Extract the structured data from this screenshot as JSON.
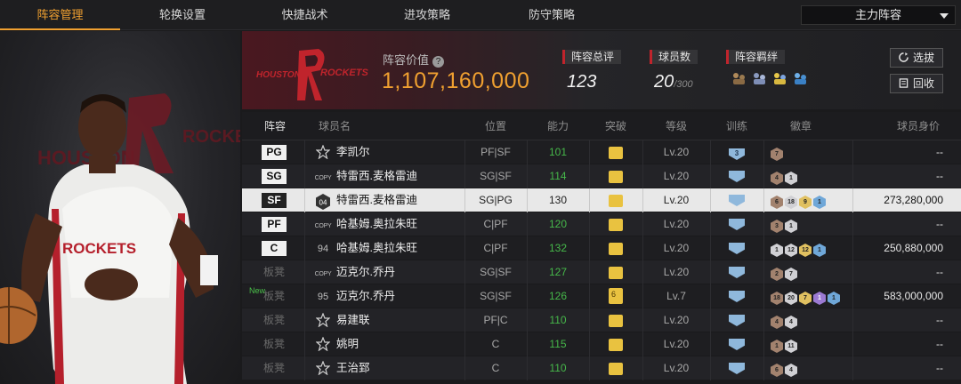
{
  "tabs": [
    {
      "label": "阵容管理",
      "active": true
    },
    {
      "label": "轮换设置",
      "active": false
    },
    {
      "label": "快捷战术",
      "active": false
    },
    {
      "label": "进攻策略",
      "active": false
    },
    {
      "label": "防守策略",
      "active": false
    }
  ],
  "lineup_select": {
    "value": "主力阵容"
  },
  "team": {
    "logo_left": "HOUSTON",
    "logo_right": "ROCKETS",
    "value_label": "阵容价值",
    "value_help": "?",
    "value": "1,107,160,000",
    "rating_label": "阵容总评",
    "rating": "123",
    "player_count_label": "球员数",
    "player_count": "20",
    "player_count_max": "/300",
    "bond_label": "阵容羁绊",
    "bond_icons": [
      "bond-icon-1",
      "bond-icon-2",
      "bond-icon-3",
      "bond-icon-4"
    ]
  },
  "buttons": {
    "select": "选拔",
    "recycle": "回收"
  },
  "hero_art": {
    "team_text_left": "HOUSTON",
    "team_text_right": "ROCKETS",
    "jersey_text": "ROCKETS"
  },
  "colors": {
    "accent": "#f0a030",
    "ability_green": "#46b84a",
    "rockets_red": "#c0242c"
  },
  "table": {
    "headers": {
      "slot": "阵容",
      "name": "球员名",
      "position": "位置",
      "ability": "能力",
      "breakthrough": "突破",
      "level": "等级",
      "training": "训练",
      "badges": "徽章",
      "price": "球员身价"
    },
    "rows": [
      {
        "slot": "PG",
        "bench": false,
        "new": "",
        "jersey": "star",
        "name": "李凯尔",
        "position": "PF|SF",
        "ability": "101",
        "breakthrough": "",
        "level": "Lv.20",
        "training": "3",
        "badges": [
          [
            "bronze",
            "7"
          ]
        ],
        "price": "--"
      },
      {
        "slot": "SG",
        "bench": false,
        "new": "",
        "jersey": "COPY",
        "name": "特雷西.麦格雷迪",
        "position": "SG|SF",
        "ability": "114",
        "breakthrough": "",
        "level": "Lv.20",
        "training": "",
        "badges": [
          [
            "bronze",
            "4"
          ],
          [
            "silver",
            "1"
          ]
        ],
        "price": "--"
      },
      {
        "slot": "SF",
        "bench": false,
        "new": "",
        "jersey": "04",
        "name": "特雷西.麦格雷迪",
        "position": "SG|PG",
        "ability": "130",
        "breakthrough": "",
        "level": "Lv.20",
        "training": "",
        "badges": [
          [
            "bronze",
            "6"
          ],
          [
            "silver",
            "18"
          ],
          [
            "gold",
            "9"
          ],
          [
            "blue",
            "1"
          ]
        ],
        "price": "273,280,000",
        "selected": true
      },
      {
        "slot": "PF",
        "bench": false,
        "new": "",
        "jersey": "COPY",
        "name": "哈基姆.奥拉朱旺",
        "position": "C|PF",
        "ability": "120",
        "breakthrough": "",
        "level": "Lv.20",
        "training": "",
        "badges": [
          [
            "bronze",
            "3"
          ],
          [
            "silver",
            "1"
          ]
        ],
        "price": "--"
      },
      {
        "slot": "C",
        "bench": false,
        "new": "",
        "jersey": "94",
        "name": "哈基姆.奥拉朱旺",
        "position": "C|PF",
        "ability": "132",
        "breakthrough": "",
        "level": "Lv.20",
        "training": "",
        "badges": [
          [
            "silver",
            "1"
          ],
          [
            "silver",
            "12"
          ],
          [
            "gold",
            "12"
          ],
          [
            "blue",
            "1"
          ]
        ],
        "price": "250,880,000"
      },
      {
        "slot": "板凳",
        "bench": true,
        "new": "",
        "jersey": "COPY",
        "name": "迈克尔.乔丹",
        "position": "SG|SF",
        "ability": "127",
        "breakthrough": "",
        "level": "Lv.20",
        "training": "",
        "badges": [
          [
            "bronze",
            "2"
          ],
          [
            "silver",
            "7"
          ]
        ],
        "price": "--"
      },
      {
        "slot": "板凳",
        "bench": true,
        "new": "New",
        "jersey": "95",
        "name": "迈克尔.乔丹",
        "position": "SG|SF",
        "ability": "126",
        "breakthrough": "6",
        "level": "Lv.7",
        "training": "",
        "badges": [
          [
            "bronze",
            "18"
          ],
          [
            "silver",
            "20"
          ],
          [
            "gold",
            "7"
          ],
          [
            "purple",
            "1"
          ],
          [
            "blue",
            "1"
          ]
        ],
        "price": "583,000,000"
      },
      {
        "slot": "板凳",
        "bench": true,
        "new": "",
        "jersey": "star",
        "name": "易建联",
        "position": "PF|C",
        "ability": "110",
        "breakthrough": "",
        "level": "Lv.20",
        "training": "",
        "badges": [
          [
            "bronze",
            "4"
          ],
          [
            "silver",
            "4"
          ]
        ],
        "price": "--"
      },
      {
        "slot": "板凳",
        "bench": true,
        "new": "",
        "jersey": "star",
        "name": "姚明",
        "position": "C",
        "ability": "115",
        "breakthrough": "",
        "level": "Lv.20",
        "training": "",
        "badges": [
          [
            "bronze",
            "1"
          ],
          [
            "silver",
            "11"
          ]
        ],
        "price": "--"
      },
      {
        "slot": "板凳",
        "bench": true,
        "new": "",
        "jersey": "star",
        "name": "王治郅",
        "position": "C",
        "ability": "110",
        "breakthrough": "",
        "level": "Lv.20",
        "training": "",
        "badges": [
          [
            "bronze",
            "6"
          ],
          [
            "silver",
            "4"
          ]
        ],
        "price": "--"
      }
    ]
  }
}
